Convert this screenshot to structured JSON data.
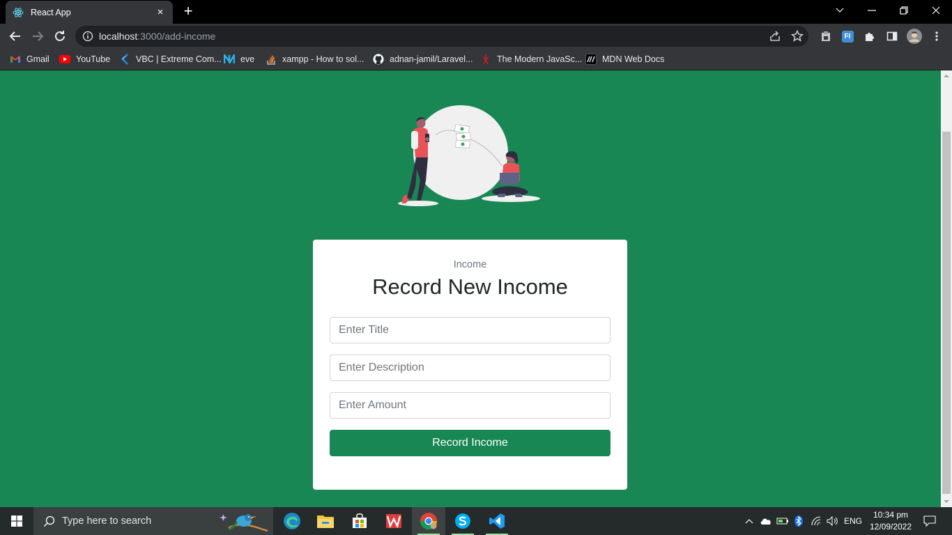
{
  "browser": {
    "tab_title": "React App",
    "tab_close": "×",
    "new_tab": "+",
    "url_host": "localhost",
    "url_path": ":3000/add-income",
    "extension_label": "FI"
  },
  "bookmarks": [
    {
      "label": "Gmail",
      "icon": "gmail-icon"
    },
    {
      "label": "YouTube",
      "icon": "youtube-icon"
    },
    {
      "label": "VBC | Extreme Com...",
      "icon": "vbc-icon"
    },
    {
      "label": "eve",
      "icon": "eve-icon"
    },
    {
      "label": "xampp - How to sol...",
      "icon": "stackoverflow-icon"
    },
    {
      "label": "adnan-jamil/Laravel...",
      "icon": "github-icon"
    },
    {
      "label": "The Modern JavaSc...",
      "icon": "javascript-info-icon"
    },
    {
      "label": "MDN Web Docs",
      "icon": "mdn-icon"
    }
  ],
  "form": {
    "eyebrow": "Income",
    "heading": "Record New Income",
    "title_placeholder": "Enter Title",
    "description_placeholder": "Enter Description",
    "amount_placeholder": "Enter Amount",
    "submit_label": "Record Income"
  },
  "taskbar": {
    "search_placeholder": "Type here to search",
    "language": "ENG",
    "time": "10:34 pm",
    "date": "12/09/2022"
  },
  "colors": {
    "page_background": "#198754",
    "button_background": "#198754",
    "card_background": "#ffffff"
  }
}
